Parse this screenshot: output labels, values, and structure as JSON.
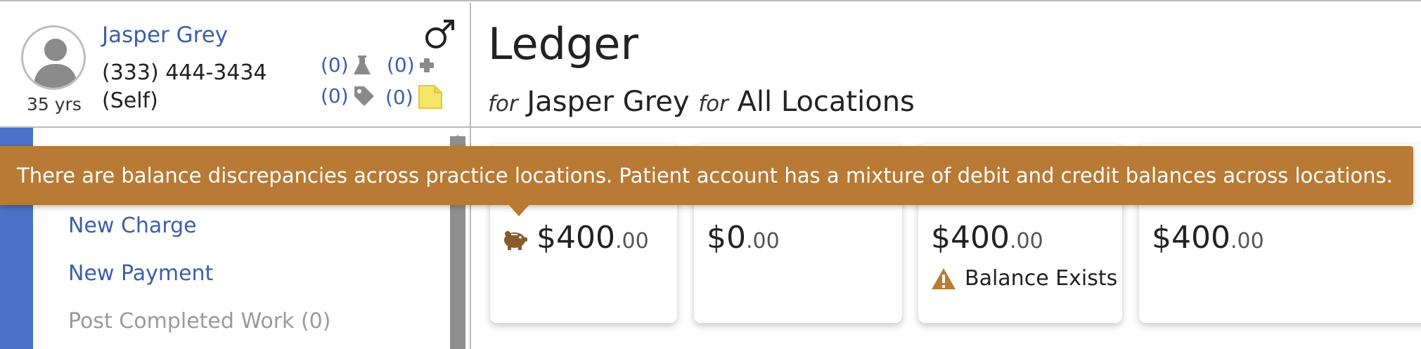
{
  "patient": {
    "name": "Jasper Grey",
    "phone": "(333) 444-3434",
    "relationship": "(Self)",
    "age": "35 yrs",
    "counters": {
      "labs": "(0)",
      "medical": "(0)",
      "tags": "(0)",
      "notes": "(0)"
    }
  },
  "ledger": {
    "title": "Ledger",
    "for_label": "for",
    "patient_name": "Jasper Grey",
    "location": "All Locations"
  },
  "alert": {
    "message": "There are balance discrepancies across practice locations. Patient account has a mixture of debit and credit balances across locations."
  },
  "menu": {
    "items": [
      {
        "label": "New Charge"
      },
      {
        "label": "New Payment"
      },
      {
        "label": "Post Completed Work (0)"
      }
    ]
  },
  "cards": [
    {
      "dollars": "$400",
      "cents": ".00"
    },
    {
      "dollars": "$0",
      "cents": ".00"
    },
    {
      "dollars": "$400",
      "cents": ".00",
      "warning": "Balance Exists"
    },
    {
      "dollars": "$400",
      "cents": ".00"
    }
  ],
  "colors": {
    "link": "#3b5fa8",
    "alert": "#b87a34",
    "accent": "#4a72c8",
    "note": "#f5e66a"
  },
  "icons": [
    "male-gender-icon",
    "flask-icon",
    "cross-icon",
    "tag-icon",
    "note-icon",
    "piggy-bank-icon",
    "warning-icon"
  ]
}
